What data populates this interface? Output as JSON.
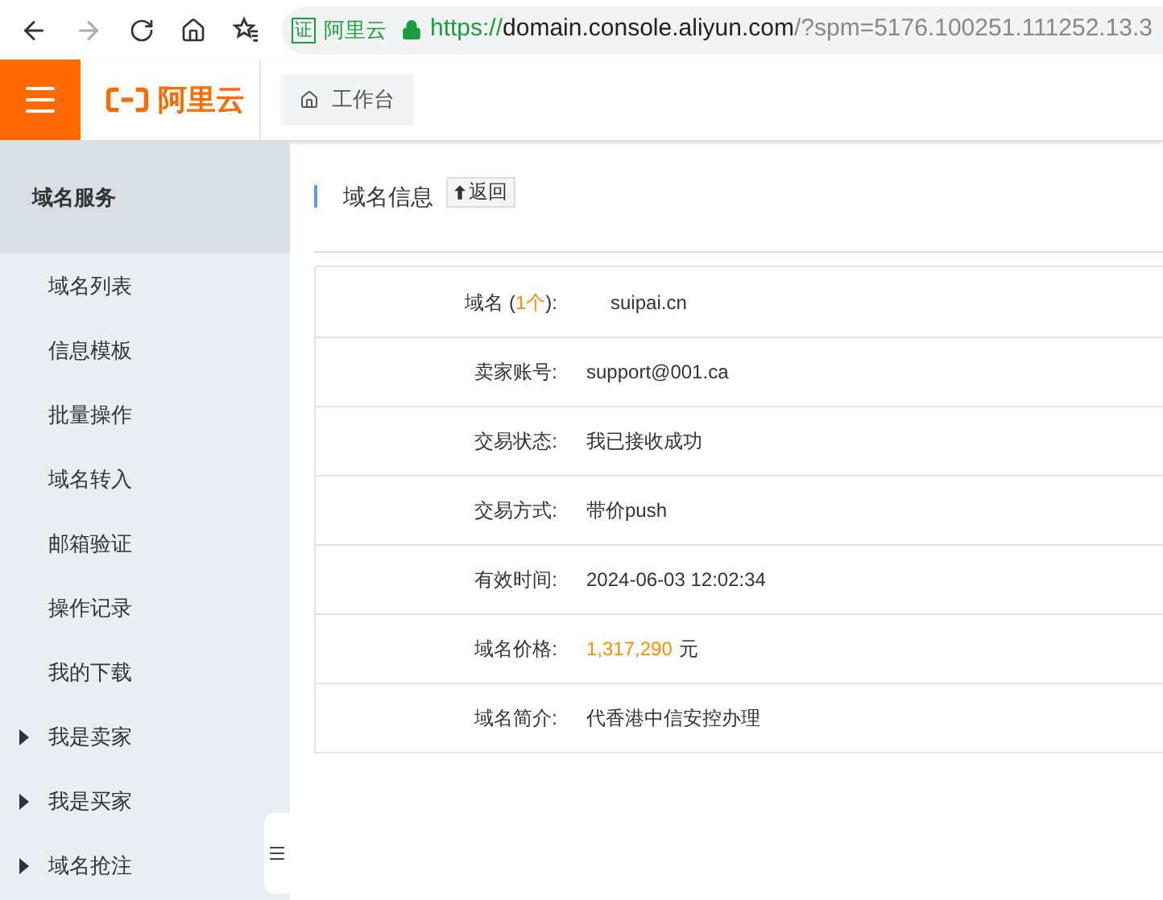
{
  "browser": {
    "badge_icon": "证",
    "badge_text": "阿里云",
    "url_scheme": "https://",
    "url_host": "domain.console.aliyun.com",
    "url_rest": "/?spm=5176.100251.111252.13.3",
    "forward_disabled": true
  },
  "header": {
    "logo_text": "阿里云",
    "workbench": "工作台"
  },
  "sidebar": {
    "title": "域名服务",
    "items": [
      {
        "label": "域名列表",
        "kind": "link"
      },
      {
        "label": "信息模板",
        "kind": "link"
      },
      {
        "label": "批量操作",
        "kind": "link"
      },
      {
        "label": "域名转入",
        "kind": "link"
      },
      {
        "label": "邮箱验证",
        "kind": "link"
      },
      {
        "label": "操作记录",
        "kind": "link"
      },
      {
        "label": "我的下载",
        "kind": "link"
      },
      {
        "label": "我是卖家",
        "kind": "group",
        "expanded": false
      },
      {
        "label": "我是买家",
        "kind": "group",
        "expanded": false
      },
      {
        "label": "域名抢注",
        "kind": "group",
        "expanded": false
      }
    ]
  },
  "page": {
    "title": "域名信息",
    "back_button": "返回"
  },
  "rows": [
    {
      "label": "域名 (",
      "label_count": "1个",
      "label_end": "):",
      "value": "suipai.cn",
      "highlight": false
    },
    {
      "label": "卖家账号:",
      "value": "support@001.ca",
      "highlight": false
    },
    {
      "label": "交易状态:",
      "value": "我已接收成功",
      "highlight": false
    },
    {
      "label": "交易方式:",
      "value": "带价push",
      "highlight": false
    },
    {
      "label": "有效时间:",
      "value": "2024-06-03 12:02:34",
      "highlight": false
    },
    {
      "label": "域名价格:",
      "value": "1,317,290",
      "unit": "元",
      "highlight": true
    },
    {
      "label": "域名简介:",
      "value": "代香港中信安控办理",
      "highlight": false
    }
  ]
}
